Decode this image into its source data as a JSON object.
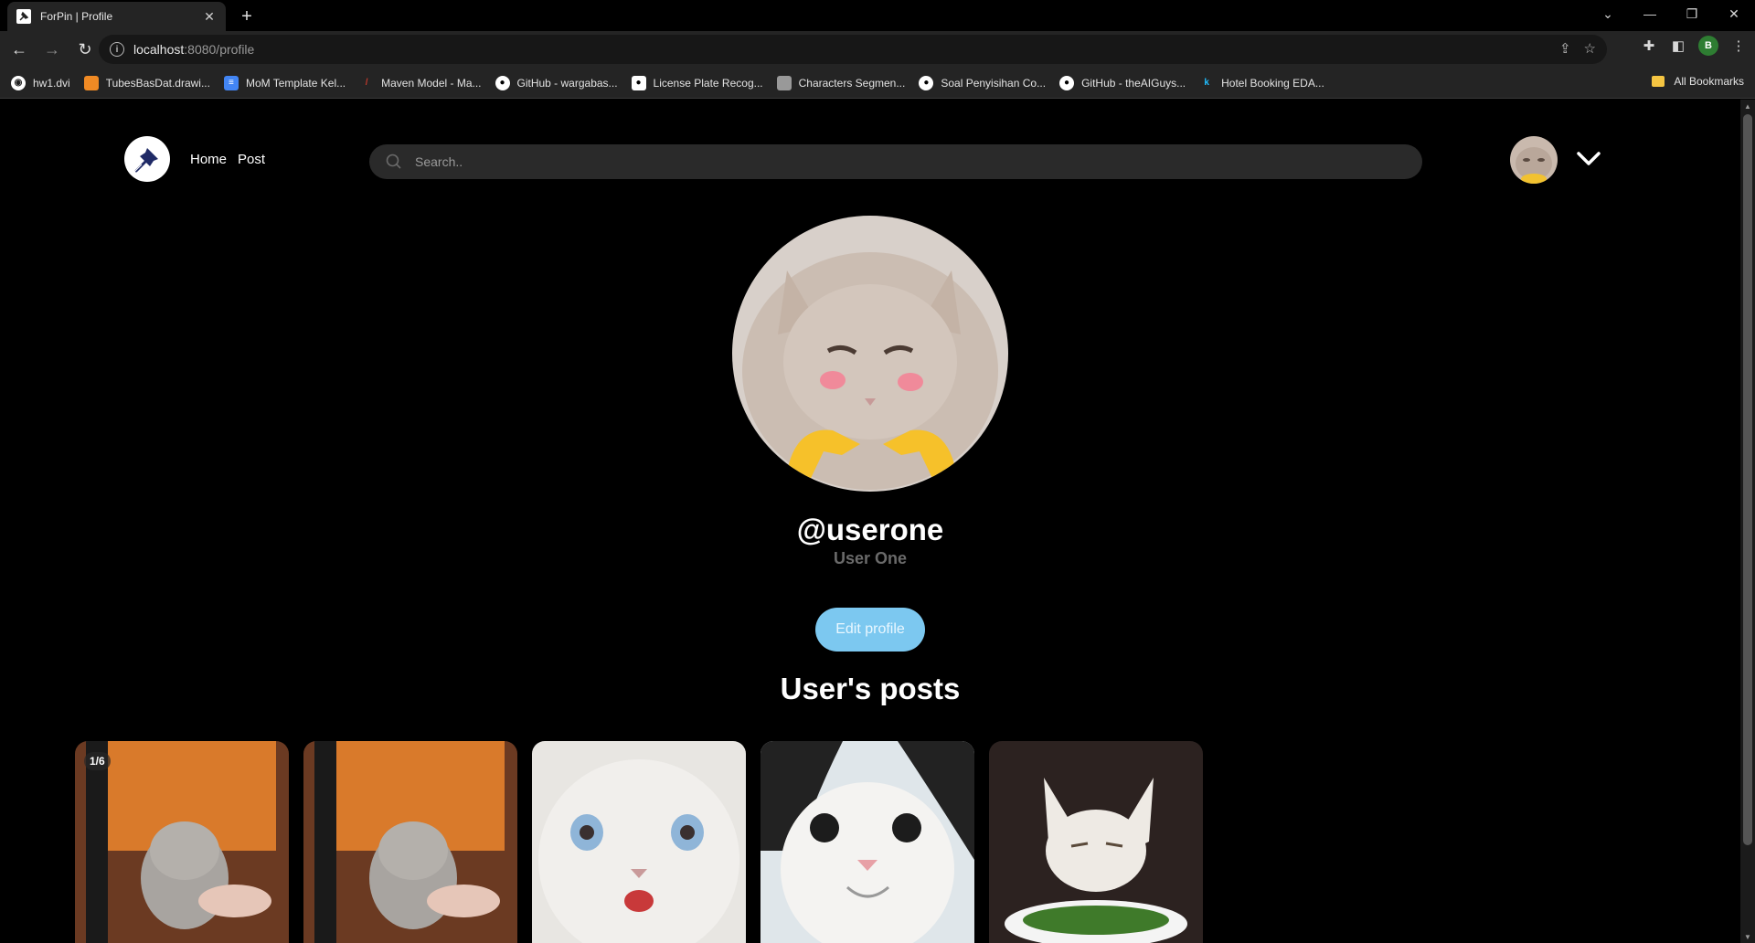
{
  "browser": {
    "tab_title": "ForPin | Profile",
    "url_host": "localhost",
    "url_path": ":8080/profile",
    "profile_initial": "B",
    "bookmarks": [
      {
        "label": "hw1.dvi",
        "color": "#ffffff"
      },
      {
        "label": "TubesBasDat.drawi...",
        "color": "#f08a24"
      },
      {
        "label": "MoM Template Kel...",
        "color": "#4285f4"
      },
      {
        "label": "Maven Model - Ma...",
        "color": "#c0392b"
      },
      {
        "label": "GitHub - wargabas...",
        "color": "#ffffff"
      },
      {
        "label": "License Plate Recog...",
        "color": "#ffffff"
      },
      {
        "label": "Characters Segmen...",
        "color": "#999999"
      },
      {
        "label": "Soal Penyisihan Co...",
        "color": "#ffffff"
      },
      {
        "label": "GitHub - theAIGuys...",
        "color": "#ffffff"
      },
      {
        "label": "Hotel Booking EDA...",
        "color": "#20beff"
      }
    ],
    "all_bookmarks": "All Bookmarks"
  },
  "nav": {
    "home": "Home",
    "post": "Post",
    "search_placeholder": "Search.."
  },
  "profile": {
    "username": "@userone",
    "full_name": "User One",
    "edit_button": "Edit profile"
  },
  "posts": {
    "heading": "User's posts",
    "first_counter": "1/6",
    "items": [
      {
        "subject": "grey cat held by hand",
        "bg": "#d97a2b"
      },
      {
        "subject": "grey cat held by hand",
        "bg": "#d97a2b"
      },
      {
        "subject": "white cat crying",
        "bg": "#e8e6e2"
      },
      {
        "subject": "black and white cat smiling",
        "bg": "#dfe6ea"
      },
      {
        "subject": "white cat at table",
        "bg": "#4a3b35"
      }
    ]
  },
  "colors": {
    "accent": "#7cc8f0",
    "background": "#000000",
    "search_bg": "#2a2a2a"
  }
}
